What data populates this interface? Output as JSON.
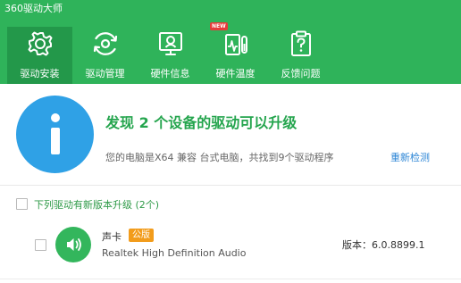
{
  "app": {
    "title": "360驱动大师"
  },
  "nav": {
    "items": [
      {
        "label": "驱动安装",
        "icon": "gear-icon"
      },
      {
        "label": "驱动管理",
        "icon": "refresh-gear-icon"
      },
      {
        "label": "硬件信息",
        "icon": "monitor-icon"
      },
      {
        "label": "硬件温度",
        "icon": "thermometer-icon",
        "badge": "NEW"
      },
      {
        "label": "反馈问题",
        "icon": "clipboard-question-icon"
      }
    ],
    "active_index": 0
  },
  "summary": {
    "headline": "发现 2 个设备的驱动可以升级",
    "scan_text": "您的电脑是X64 兼容 台式电脑，共找到9个驱动程序",
    "rescan_label": "重新检测"
  },
  "section": {
    "label": "下列驱动有新版本升级 (2个)"
  },
  "drivers": [
    {
      "name": "声卡",
      "badge": "公版",
      "description": "Realtek High Definition Audio",
      "version": "版本：6.0.8899.1",
      "icon": "speaker-icon"
    }
  ],
  "colors": {
    "header_bg": "#2fb35a",
    "active_tab_bg": "#23984a",
    "info_blue": "#2fa1e6",
    "headline_green": "#25a54e",
    "link_blue": "#2d86d6",
    "badge_orange": "#f29c1b",
    "new_badge_red": "#e73b3b"
  }
}
